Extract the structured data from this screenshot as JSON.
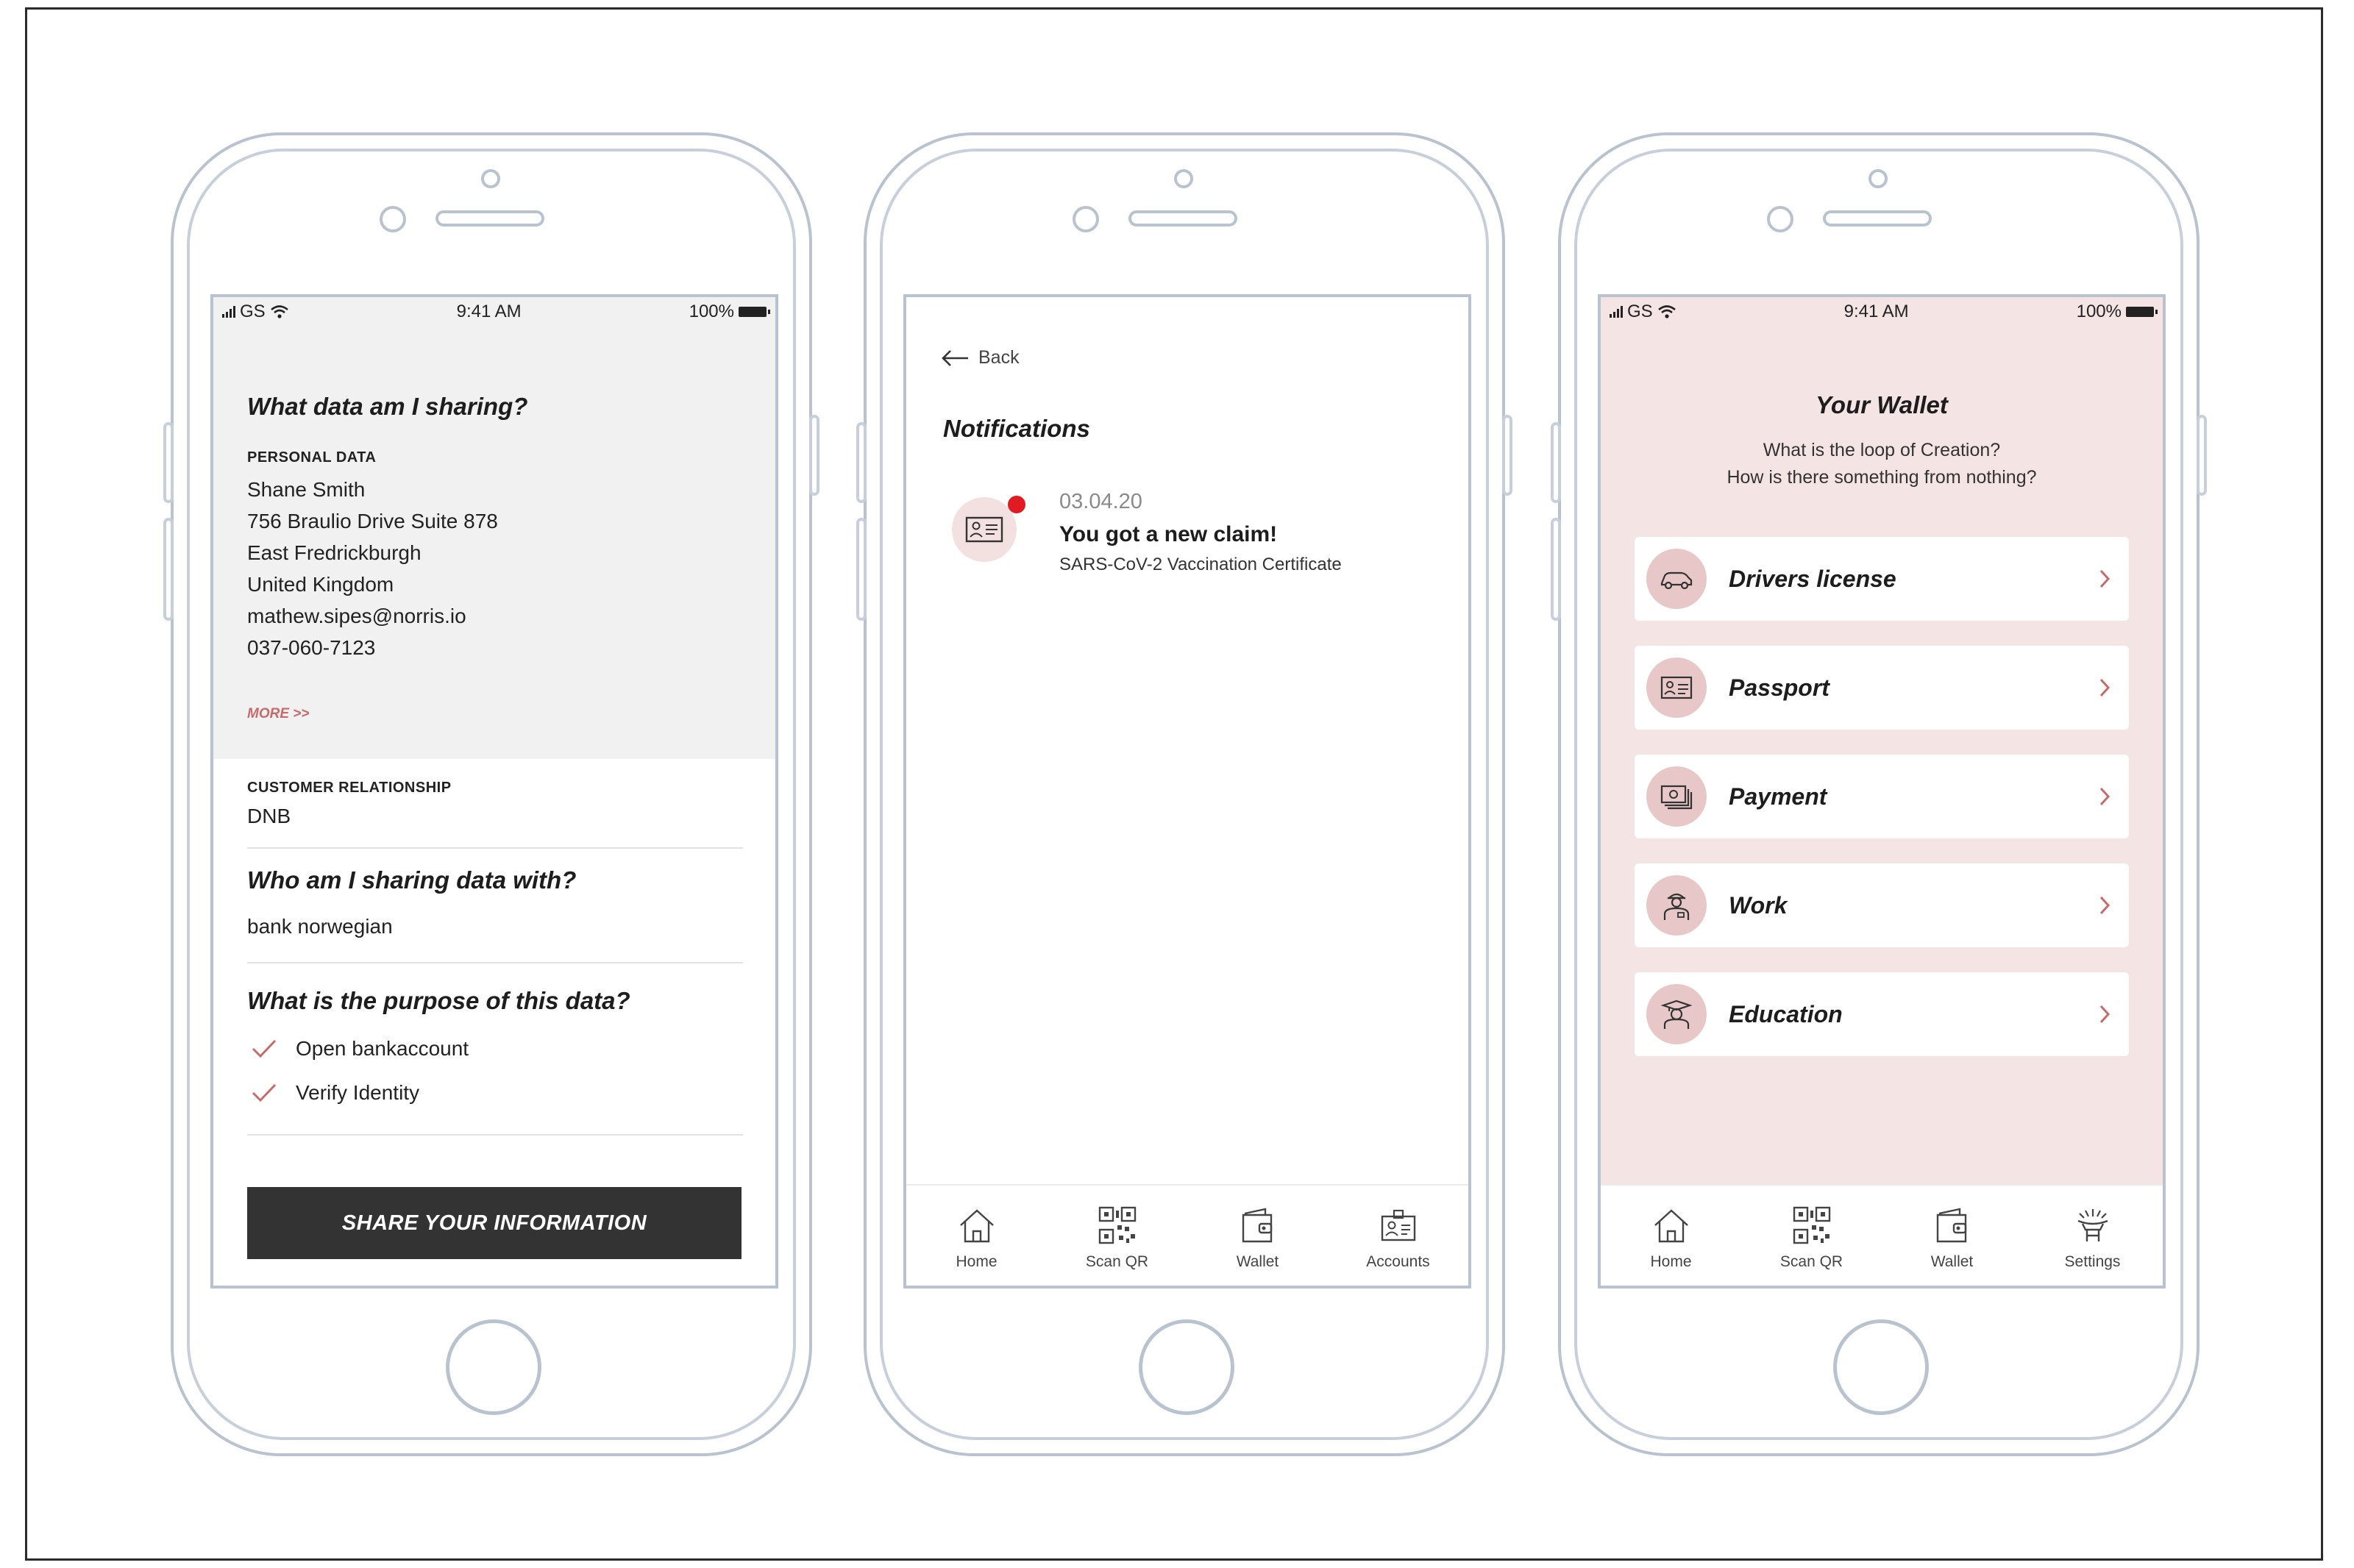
{
  "status_bar": {
    "carrier": "GS",
    "time": "9:41 AM",
    "battery": "100%"
  },
  "sharing": {
    "title": "What data am I sharing?",
    "personal_data_label": "PERSONAL DATA",
    "personal_data": [
      "Shane Smith",
      "756 Braulio Drive Suite 878",
      "East Fredrickburgh",
      "United Kingdom",
      "mathew.sipes@norris.io",
      "037-060-7123"
    ],
    "more_label": "MORE >>",
    "customer_relationship_label": "CUSTOMER RELATIONSHIP",
    "customer_relationship_value": "DNB",
    "who_title": "Who am I sharing data with?",
    "who_value": "bank norwegian",
    "purpose_title": "What is the purpose of this data?",
    "purposes": [
      "Open bankaccount",
      "Verify Identity"
    ],
    "share_button": "SHARE YOUR INFORMATION"
  },
  "notifications": {
    "back_label": "Back",
    "title": "Notifications",
    "item": {
      "date": "03.04.20",
      "headline": "You got a new claim!",
      "detail": "SARS-CoV-2 Vaccination Certificate"
    }
  },
  "tabbar_2": [
    {
      "label": "Home",
      "icon": "home-icon"
    },
    {
      "label": "Scan QR",
      "icon": "qr-icon"
    },
    {
      "label": "Wallet",
      "icon": "wallet-icon"
    },
    {
      "label": "Accounts",
      "icon": "accounts-icon"
    }
  ],
  "wallet": {
    "title": "Your Wallet",
    "subtitle_line1": "What is the loop of Creation?",
    "subtitle_line2": "How is there something from nothing?",
    "cards": [
      {
        "label": "Drivers license",
        "icon": "car-icon"
      },
      {
        "label": "Passport",
        "icon": "id-card-icon"
      },
      {
        "label": "Payment",
        "icon": "money-icon"
      },
      {
        "label": "Work",
        "icon": "worker-icon"
      },
      {
        "label": "Education",
        "icon": "graduate-icon"
      }
    ]
  },
  "tabbar_3": [
    {
      "label": "Home",
      "icon": "home-icon"
    },
    {
      "label": "Scan QR",
      "icon": "qr-icon"
    },
    {
      "label": "Wallet",
      "icon": "wallet-icon"
    },
    {
      "label": "Settings",
      "icon": "settings-icon"
    }
  ],
  "colors": {
    "accent_pink": "#f4e4e4",
    "icon_bg": "#e7c7c7",
    "notif_dot": "#e11b22",
    "button_dark": "#333333",
    "more_link": "#c96a6a"
  }
}
